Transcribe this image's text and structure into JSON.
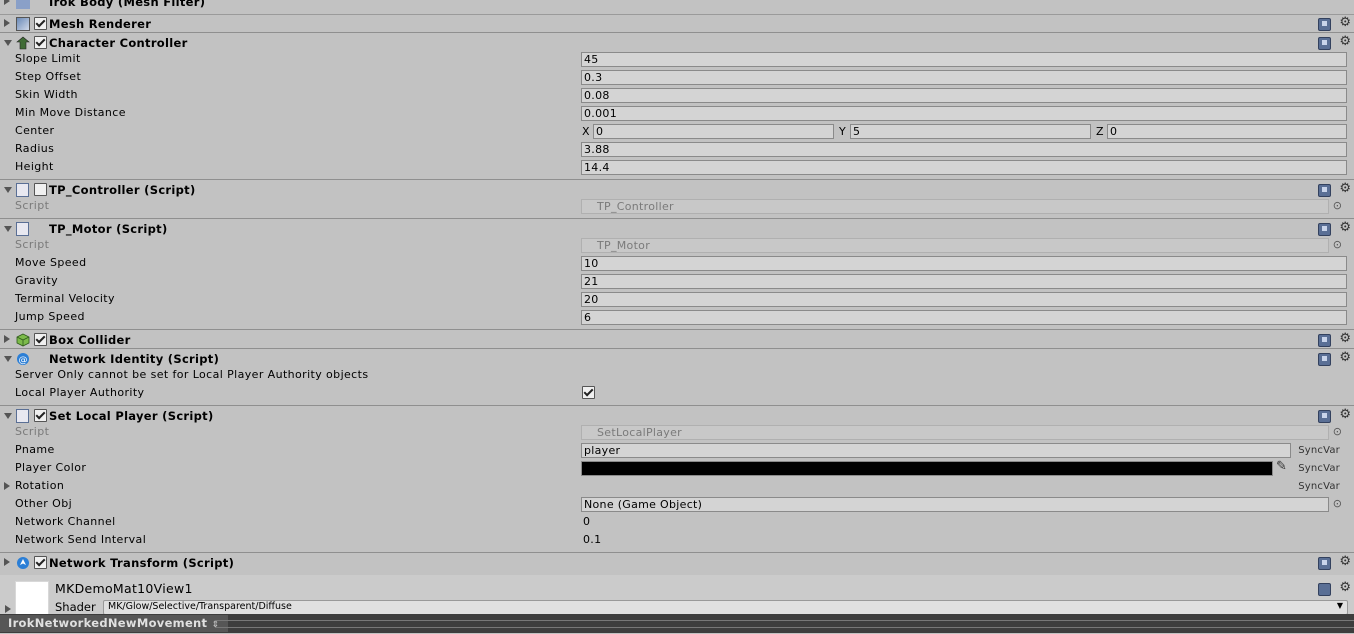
{
  "top_clipped": {
    "title": "Irok Body (Mesh Filter)"
  },
  "components": {
    "mesh_renderer": {
      "title": "Mesh Renderer"
    },
    "character_controller": {
      "title": "Character Controller",
      "fields": [
        {
          "label": "Slope Limit",
          "value": "45"
        },
        {
          "label": "Step Offset",
          "value": "0.3"
        },
        {
          "label": "Skin Width",
          "value": "0.08"
        },
        {
          "label": "Min Move Distance",
          "value": "0.001"
        },
        {
          "label": "Center",
          "x": "0",
          "y": "5",
          "z": "0"
        },
        {
          "label": "Radius",
          "value": "3.88"
        },
        {
          "label": "Height",
          "value": "14.4"
        }
      ]
    },
    "tp_controller": {
      "title": "TP_Controller (Script)",
      "script_label": "Script",
      "script_value": "TP_Controller"
    },
    "tp_motor": {
      "title": "TP_Motor (Script)",
      "script_label": "Script",
      "script_value": "TP_Motor",
      "fields": [
        {
          "label": "Move Speed",
          "value": "10"
        },
        {
          "label": "Gravity",
          "value": "21"
        },
        {
          "label": "Terminal Velocity",
          "value": "20"
        },
        {
          "label": "Jump Speed",
          "value": "6"
        }
      ]
    },
    "box_collider": {
      "title": "Box Collider"
    },
    "network_identity": {
      "title": "Network Identity (Script)",
      "message": "Server Only cannot be set for Local Player Authority objects",
      "lpa_label": "Local Player Authority"
    },
    "set_local_player": {
      "title": "Set Local Player (Script)",
      "script_label": "Script",
      "script_value": "SetLocalPlayer",
      "pname_label": "Pname",
      "pname_value": "player",
      "color_label": "Player Color",
      "color_value": "#000000",
      "rotation_label": "Rotation",
      "otherobj_label": "Other Obj",
      "otherobj_value": "None (Game Object)",
      "channel_label": "Network Channel",
      "channel_value": "0",
      "interval_label": "Network Send Interval",
      "interval_value": "0.1",
      "syncvar": "SyncVar"
    },
    "network_transform": {
      "title": "Network Transform (Script)"
    }
  },
  "material": {
    "name": "MKDemoMat10View1",
    "shader_label": "Shader",
    "shader_value": "MK/Glow/Selective/Transparent/Diffuse"
  },
  "footer": {
    "tab_label": "IrokNetworkedNewMovement"
  },
  "axes": {
    "x": "X",
    "y": "Y",
    "z": "Z"
  }
}
